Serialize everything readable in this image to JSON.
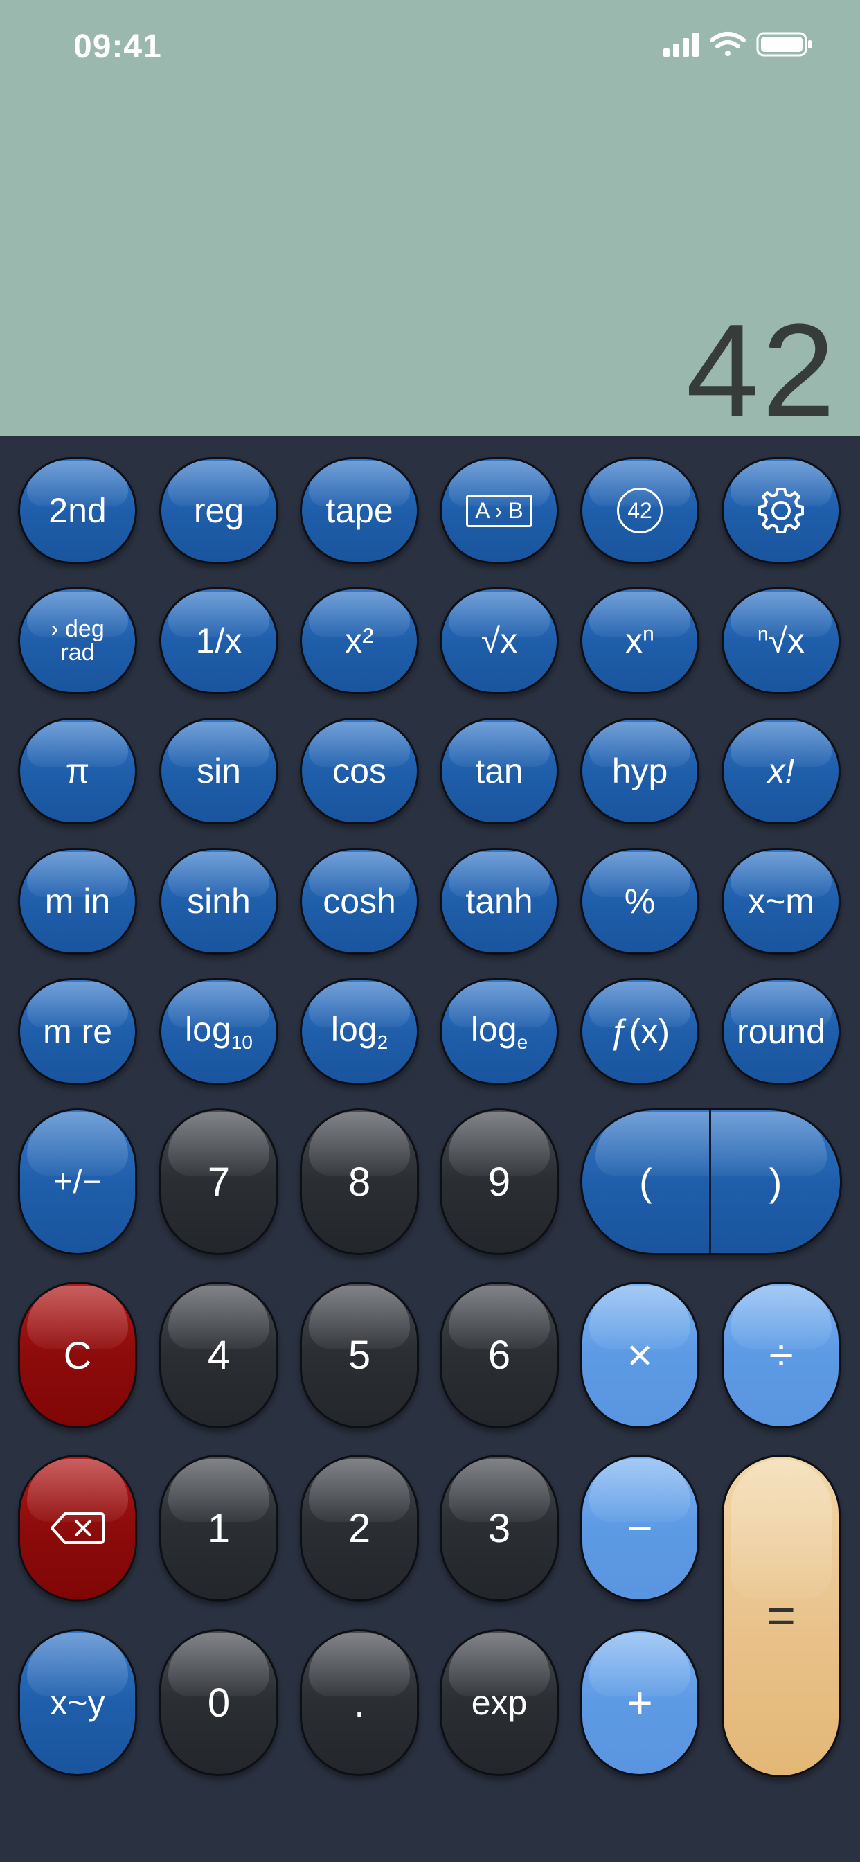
{
  "status_bar": {
    "time": "09:41",
    "icons": [
      "cellular-signal-icon",
      "wifi-icon",
      "battery-icon"
    ]
  },
  "display": {
    "value": "42"
  },
  "keys": {
    "second": "2nd",
    "reg": "reg",
    "tape": "tape",
    "ab": "A › B",
    "badge": "42",
    "settings_icon": "gear-icon",
    "deg": "› deg",
    "rad": "rad",
    "recip": "1/x",
    "square": "x²",
    "sqrt": "√x",
    "power_base": "x",
    "power_exp": "n",
    "root_idx": "n",
    "root": "√x",
    "pi": "π",
    "sin": "sin",
    "cos": "cos",
    "tan": "tan",
    "hyp": "hyp",
    "fact": "x!",
    "min": "m in",
    "sinh": "sinh",
    "cosh": "cosh",
    "tanh": "tanh",
    "percent": "%",
    "xm": "x~m",
    "mre": "m re",
    "log": "log",
    "log10_sub": "10",
    "log2_sub": "2",
    "loge_sub": "e",
    "fx": "ƒ(x)",
    "round": "round",
    "sign": "+/−",
    "d7": "7",
    "d8": "8",
    "d9": "9",
    "lparen": "(",
    "rparen": ")",
    "clear": "C",
    "d4": "4",
    "d5": "5",
    "d6": "6",
    "mul": "×",
    "div": "÷",
    "backspace_icon": "backspace-icon",
    "d1": "1",
    "d2": "2",
    "d3": "3",
    "minus": "−",
    "equals": "=",
    "xy": "x~y",
    "d0": "0",
    "dot": ".",
    "exp": "exp",
    "plus": "+"
  },
  "colors": {
    "display_bg": "#9ab8ad",
    "keypad_bg": "#2a3140",
    "function_key": "#1f5eaa",
    "digit_key": "#2b2e33",
    "operator_key": "#5d9ae4",
    "clear_key": "#8d0b0b",
    "equals_key": "#e8c088"
  }
}
